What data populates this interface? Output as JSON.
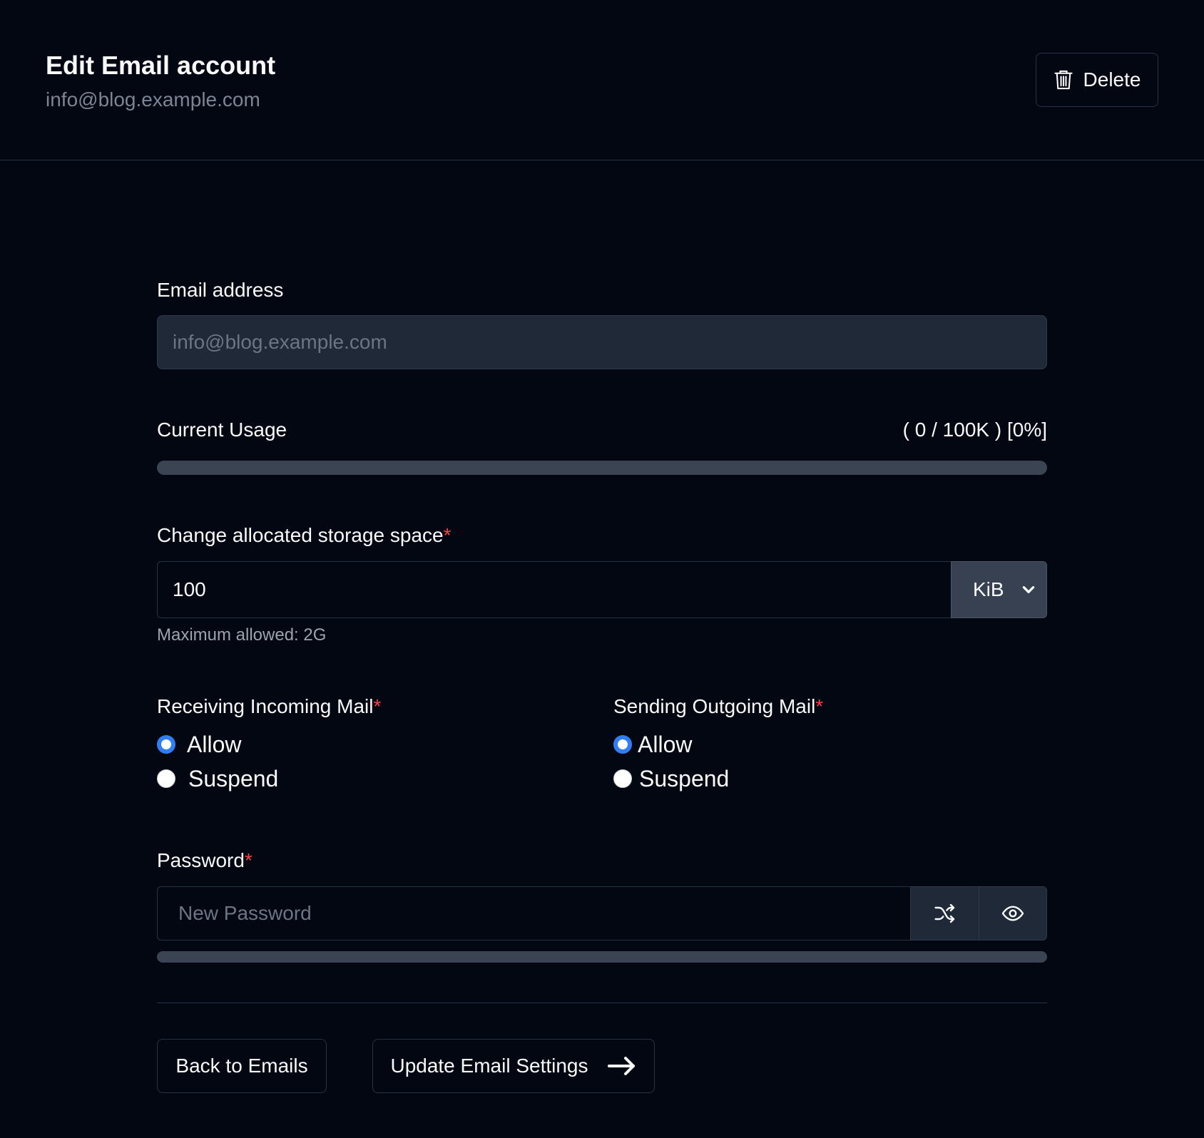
{
  "header": {
    "title": "Edit Email account",
    "subtitle": "info@blog.example.com",
    "delete_label": "Delete",
    "delete_icon": "trash-icon"
  },
  "form": {
    "email": {
      "label": "Email address",
      "value": "info@blog.example.com"
    },
    "usage": {
      "label": "Current Usage",
      "value_text": "( 0 / 100K ) [0%]",
      "percent": 0
    },
    "storage": {
      "label": "Change allocated storage space",
      "required_mark": "*",
      "value": "100",
      "unit": "KiB",
      "unit_icon": "chevron-down-icon",
      "helper": "Maximum allowed: 2G"
    },
    "incoming": {
      "label": "Receiving Incoming Mail",
      "required_mark": "*",
      "options": [
        "Allow",
        "Suspend"
      ],
      "selected": "Allow"
    },
    "outgoing": {
      "label": "Sending Outgoing Mail",
      "required_mark": "*",
      "options": [
        "Allow",
        "Suspend"
      ],
      "selected": "Allow"
    },
    "password": {
      "label": "Password",
      "required_mark": "*",
      "placeholder": "New Password",
      "value": "",
      "strength_percent": 0,
      "generate_icon": "shuffle-icon",
      "toggle_icon": "eye-icon"
    }
  },
  "actions": {
    "back_label": "Back to Emails",
    "update_label": "Update Email Settings",
    "update_icon": "arrow-right-icon"
  },
  "colors": {
    "background": "#030711",
    "border": "#283241",
    "accent": "#2f7ef5",
    "required": "#ef4444",
    "muted_text": "#7c8594"
  }
}
